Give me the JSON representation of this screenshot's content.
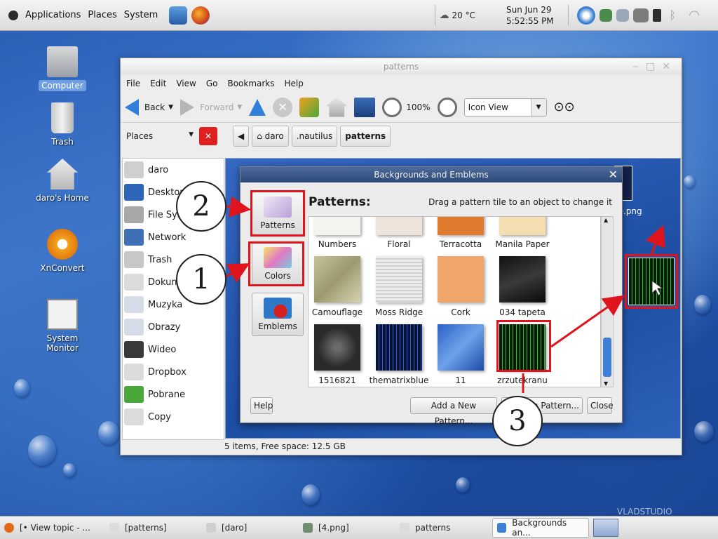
{
  "top_panel": {
    "menus": [
      "Applications",
      "Places",
      "System"
    ],
    "weather": "20 °C",
    "clock_date": "Sun Jun 29",
    "clock_time": "5:52:55 PM"
  },
  "desktop": {
    "icons": [
      {
        "label": "Computer"
      },
      {
        "label": "Trash"
      },
      {
        "label": "daro's Home"
      },
      {
        "label": "XnConvert"
      },
      {
        "label": "System Monitor"
      }
    ]
  },
  "window": {
    "title": "patterns",
    "menu": [
      "File",
      "Edit",
      "View",
      "Go",
      "Bookmarks",
      "Help"
    ],
    "toolbar": {
      "back": "Back",
      "forward": "Forward",
      "zoom": "100%",
      "view_mode": "Icon View"
    },
    "places_label": "Places",
    "breadcrumbs": [
      "daro",
      ".nautilus",
      "patterns"
    ],
    "sidebar": [
      "daro",
      "Desktop",
      "File Syst",
      "Network",
      "Trash",
      "Dokum",
      "Muzyka",
      "Obrazy",
      "Wideo",
      "Dropbox",
      "Pobrane",
      "Copy"
    ],
    "status": "5 items, Free space: 12.5 GB",
    "partial_file": "ue.png"
  },
  "dialog": {
    "title": "Backgrounds and Emblems",
    "categories": [
      "Patterns",
      "Colors",
      "Emblems"
    ],
    "heading": "Patterns:",
    "hint": "Drag a pattern tile to an object to change it",
    "patterns": [
      "Numbers",
      "Floral",
      "Terracotta",
      "Manila Paper",
      "Camouflage",
      "Moss Ridge",
      "Cork",
      "034 tapeta",
      "1516821",
      "thematrixblue",
      "11",
      "zrzutekranu"
    ],
    "buttons": {
      "help": "Help",
      "add": "Add a New Pattern...",
      "remove": "a Pattern...",
      "close": "Close"
    }
  },
  "annotations": [
    "1",
    "2",
    "3"
  ],
  "taskbar": [
    "[• View topic - ...",
    "[patterns]",
    "[daro]",
    "[4.png]",
    "patterns",
    "Backgrounds an..."
  ],
  "watermark": "VLADSTUDIO",
  "colors": {
    "annotation_red": "#e0141c",
    "accent_blue": "#2f7fdb"
  }
}
